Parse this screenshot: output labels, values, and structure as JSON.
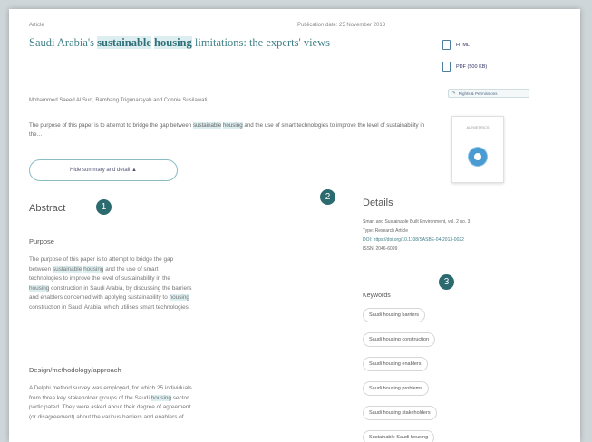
{
  "article": {
    "type_label": "Article",
    "publication_date": "Publication date: 25 November 2013",
    "title_pre": "Saudi Arabia's ",
    "title_hl1": "sustainable",
    "title_hl2": "housing",
    "title_post": " limitations: the experts' views",
    "authors": "Mohammed Saeed Al Surf, Bambang Trigunarsyah and Connie Susilawati",
    "summary_pre": "The purpose of this paper is to attempt to bridge the gap between ",
    "summary_hl1": "sustainable",
    "summary_hl2": "housing",
    "summary_post": " and the use of smart technologies to improve the level of sustainability in the…",
    "toggle_label": "Hide summary and detail ▲"
  },
  "sidebar": {
    "html_label": "HTML",
    "pdf_label": "PDF (500 KB)",
    "permissions_label": "Rights & Permissions",
    "metrics_label": "ALTMETRICS"
  },
  "abstract": {
    "heading": "Abstract",
    "badge": "1",
    "purpose_heading": "Purpose",
    "purpose_text": {
      "l1": "The purpose of this paper is to attempt to bridge the gap",
      "l2a": "between ",
      "l2h1": "sustainable",
      "l2h2": "housing",
      "l2b": " and the use of smart",
      "l3": "technologies to improve the level of sustainability in the",
      "l4h": "housing",
      "l4b": " construction in Saudi Arabia, by discussing the barriers",
      "l5a": "and enablers concerned with applying sustainability to ",
      "l5h": "housing",
      "l6": "construction in Saudi Arabia, which utilises smart technologies."
    },
    "design_heading": "Design/methodology/approach",
    "design_text": {
      "l1": "A Delphi method survey was employed, for which 25 individuals",
      "l2a": "from three key stakeholder groups of the Saudi ",
      "l2h": "housing",
      "l2b": " sector",
      "l3": "participated. They were asked about their degree of agreement",
      "l4": "(or disagreement) about the various barriers and enablers of"
    }
  },
  "details": {
    "heading": "Details",
    "badge": "2",
    "journal": "Smart and Sustainable Built Environment, vol. 2 no. 3",
    "type": "Type: Research Article",
    "doi": "DOI: https://doi.org/10.1108/SASBE-04-2013-0022",
    "issn": "ISSN: 2046-6099"
  },
  "keywords": {
    "heading": "Keywords",
    "badge": "3",
    "items": [
      "Saudi housing barriers",
      "Saudi housing construction",
      "Saudi housing enablers",
      "Saudi housing problems",
      "Saudi housing stakeholders",
      "Sustainable Saudi housing"
    ]
  },
  "colors": {
    "accent": "#3f7f88",
    "badge": "#2b6a6e",
    "highlight": "#dceef0"
  }
}
